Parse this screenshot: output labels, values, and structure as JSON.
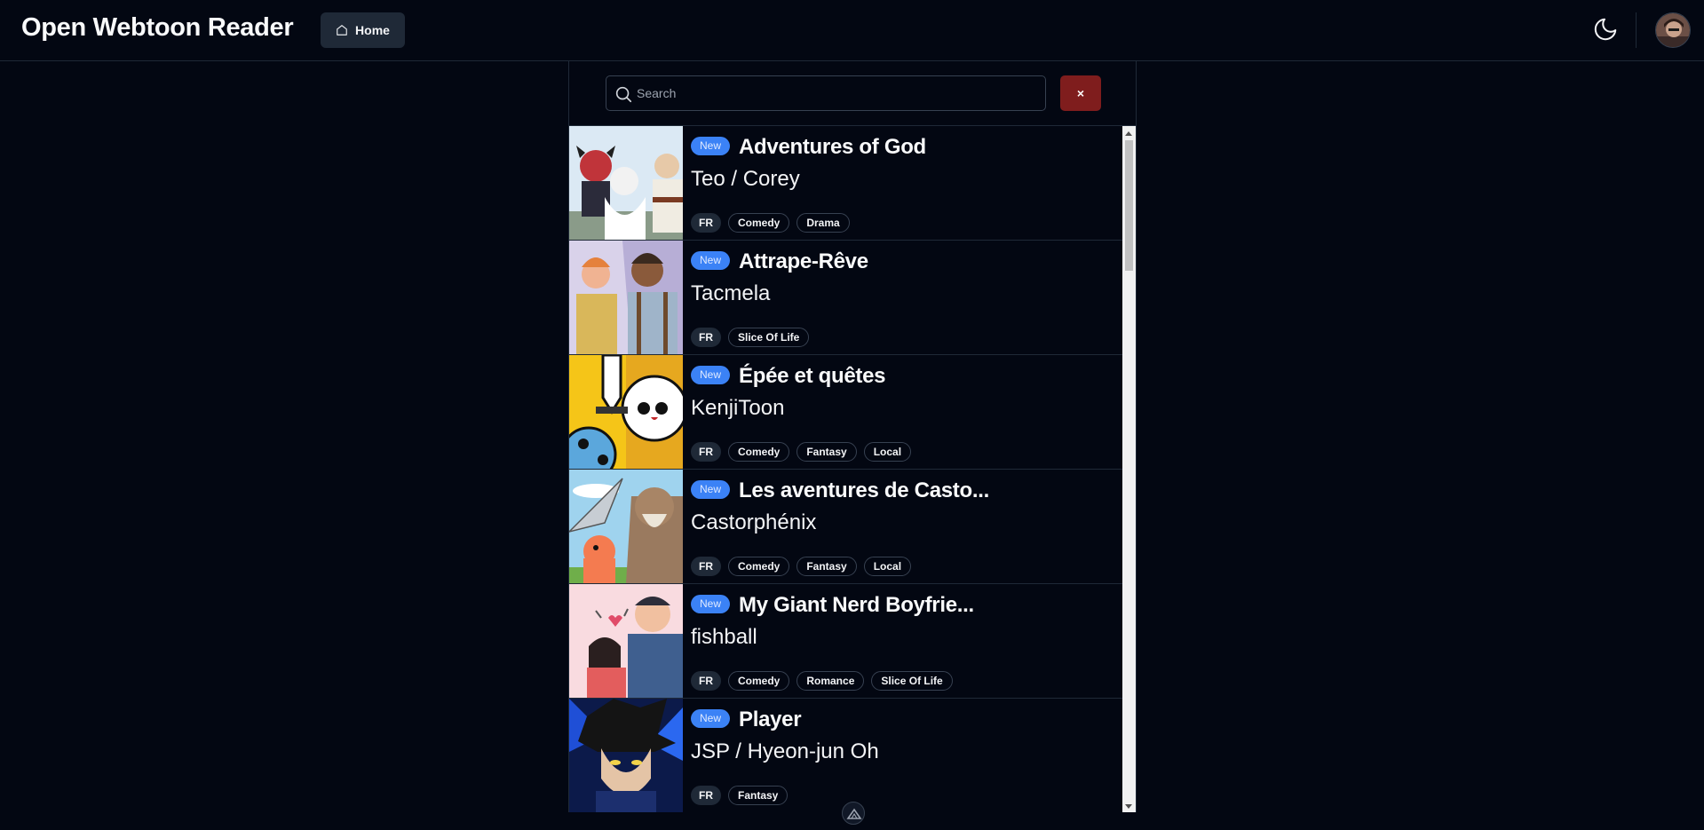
{
  "header": {
    "brand": "Open Webtoon Reader",
    "home_label": "Home"
  },
  "search": {
    "placeholder": "Search",
    "value": "",
    "clear_label": "×"
  },
  "list": {
    "items": [
      {
        "badge": "New",
        "title": "Adventures of God",
        "author": "Teo / Corey",
        "lang": "FR",
        "genres": [
          "Comedy",
          "Drama"
        ]
      },
      {
        "badge": "New",
        "title": "Attrape-Rêve",
        "author": "Tacmela",
        "lang": "FR",
        "genres": [
          "Slice Of Life"
        ]
      },
      {
        "badge": "New",
        "title": "Épée et quêtes",
        "author": "KenjiToon",
        "lang": "FR",
        "genres": [
          "Comedy",
          "Fantasy",
          "Local"
        ]
      },
      {
        "badge": "New",
        "title": "Les aventures de Casto...",
        "author": "Castorphénix",
        "lang": "FR",
        "genres": [
          "Comedy",
          "Fantasy",
          "Local"
        ]
      },
      {
        "badge": "New",
        "title": "My Giant Nerd Boyfrie...",
        "author": "fishball",
        "lang": "FR",
        "genres": [
          "Comedy",
          "Romance",
          "Slice Of Life"
        ]
      },
      {
        "badge": "New",
        "title": "Player",
        "author": "JSP / Hyeon-jun Oh",
        "lang": "FR",
        "genres": [
          "Fantasy"
        ]
      }
    ]
  },
  "colors": {
    "background": "#030712",
    "accent_badge": "#3b82f6",
    "clear_button": "#7f1d1d",
    "home_button": "#1f2937"
  },
  "icons": {
    "home": "home-icon",
    "search": "search-icon",
    "theme": "moon-icon"
  }
}
